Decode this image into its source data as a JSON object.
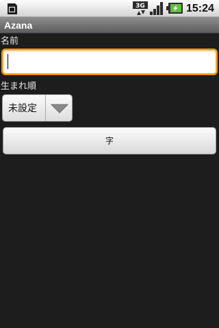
{
  "status_bar": {
    "time": "15:24",
    "network_text": "3G",
    "icons": {
      "sim": "sd-card-icon",
      "network": "3g-data-icon",
      "signal": "signal-strength-icon",
      "battery": "battery-charging-icon"
    },
    "battery_level": 0.8
  },
  "title_bar": {
    "title": "Azana"
  },
  "form": {
    "name_label": "名前",
    "name_value": "",
    "name_placeholder": "",
    "order_label": "生まれ順",
    "order_selected": "未設定",
    "char_button_label": "字"
  },
  "colors": {
    "focus_border": "#ff9200",
    "background": "#1d1d1d",
    "title_bar": "#6f6f6f"
  }
}
